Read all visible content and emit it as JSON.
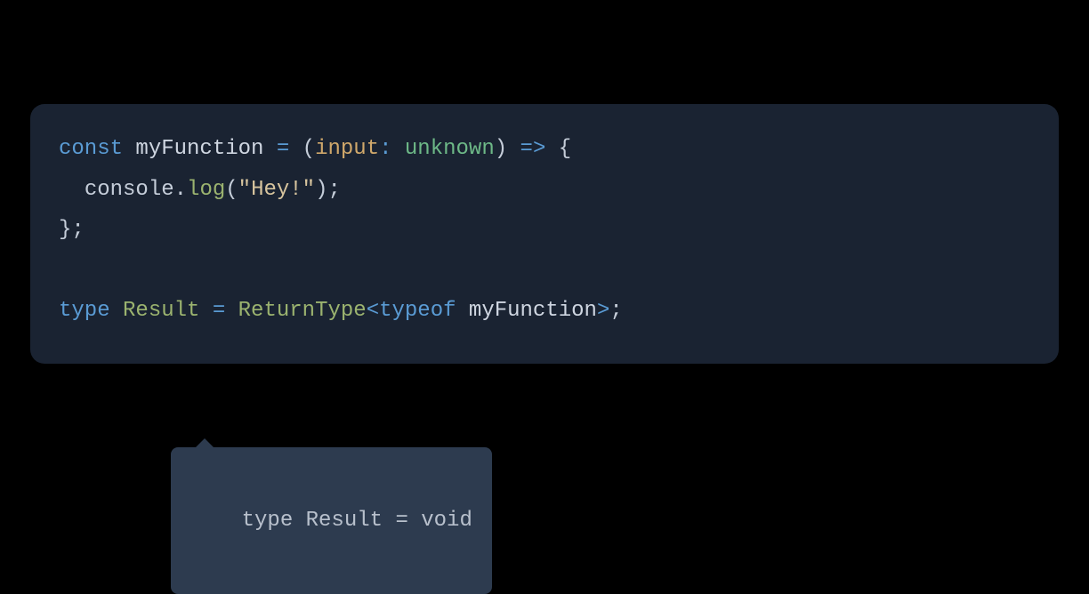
{
  "code": {
    "line1": {
      "const": "const",
      "name": "myFunction",
      "assign": " = ",
      "paren_open": "(",
      "param": "input",
      "colon": ": ",
      "param_type": "unknown",
      "paren_close": ")",
      "arrow": " => ",
      "brace_open": "{"
    },
    "line2": {
      "indent": "  ",
      "obj": "console",
      "dot": ".",
      "method": "log",
      "paren_open": "(",
      "string": "\"Hey!\"",
      "paren_close": ")",
      "semi": ";"
    },
    "line3": {
      "brace_close": "}",
      "semi": ";"
    },
    "line5": {
      "type_kw": "type",
      "space1": " ",
      "type_name": "Result",
      "assign": " = ",
      "util": "ReturnType",
      "angle_open": "<",
      "typeof": "typeof",
      "space2": " ",
      "ref": "myFunction",
      "angle_close": ">",
      "semi": ";"
    }
  },
  "tooltip": {
    "text": "type Result = void"
  }
}
